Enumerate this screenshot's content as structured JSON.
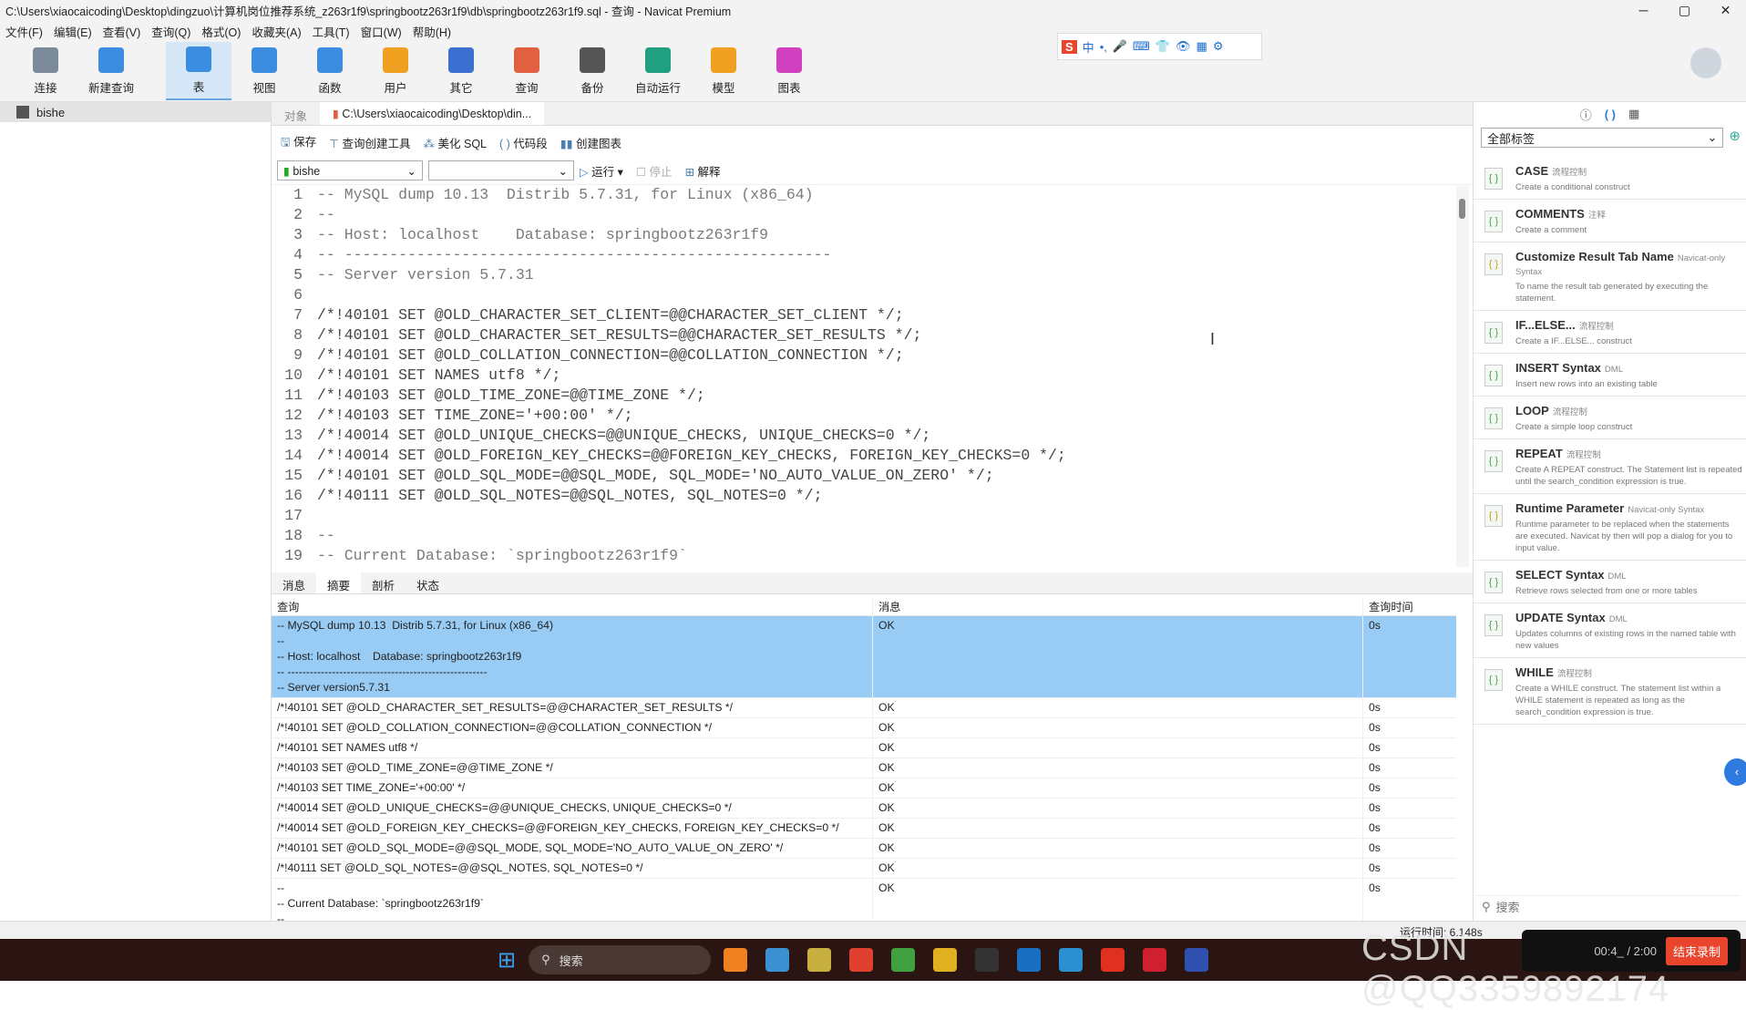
{
  "window": {
    "title": "C:\\Users\\xiaocaicoding\\Desktop\\dingzuo\\计算机岗位推荐系统_z263r1f9\\springbootz263r1f9\\db\\springbootz263r1f9.sql - 查询 - Navicat Premium",
    "minimize": "─",
    "maximize": "▢",
    "close": "✕"
  },
  "menu": [
    "文件(F)",
    "编辑(E)",
    "查看(V)",
    "查询(Q)",
    "格式(O)",
    "收藏夹(A)",
    "工具(T)",
    "窗口(W)",
    "帮助(H)"
  ],
  "toolbar": [
    {
      "label": "连接",
      "color": "#7a8a99"
    },
    {
      "label": "新建查询",
      "color": "#3b8de0"
    },
    {
      "label": "表",
      "color": "#3b8de0",
      "active": true
    },
    {
      "label": "视图",
      "color": "#3b8de0"
    },
    {
      "label": "函数",
      "color": "#3b8de0"
    },
    {
      "label": "用户",
      "color": "#f0a020"
    },
    {
      "label": "其它",
      "color": "#3b6fd0"
    },
    {
      "label": "查询",
      "color": "#e06040"
    },
    {
      "label": "备份",
      "color": "#555"
    },
    {
      "label": "自动运行",
      "color": "#20a080"
    },
    {
      "label": "模型",
      "color": "#f0a020"
    },
    {
      "label": "图表",
      "color": "#d040c0"
    }
  ],
  "ime": [
    "S",
    "中",
    "•,",
    "🎤",
    "⌨",
    "👕",
    "👁",
    "▦",
    "⚙"
  ],
  "sidebar": {
    "connection": "bishe"
  },
  "tabs": {
    "objects": "对象",
    "query": "C:\\Users\\xiaocaicoding\\Desktop\\din..."
  },
  "editor_toolbar": {
    "save": "保存",
    "builder": "查询创建工具",
    "beautify": "美化 SQL",
    "snippet": "代码段",
    "chart": "创建图表"
  },
  "selectors": {
    "connection": "bishe",
    "database": "",
    "run": "运行",
    "stop": "停止",
    "explain": "解释"
  },
  "code": [
    "-- MySQL dump 10.13  Distrib 5.7.31, for Linux (x86_64)",
    "--",
    "-- Host: localhost    Database: springbootz263r1f9",
    "-- ------------------------------------------------------",
    "-- Server version 5.7.31",
    "",
    "/*!40101 SET @OLD_CHARACTER_SET_CLIENT=@@CHARACTER_SET_CLIENT */;",
    "/*!40101 SET @OLD_CHARACTER_SET_RESULTS=@@CHARACTER_SET_RESULTS */;",
    "/*!40101 SET @OLD_COLLATION_CONNECTION=@@COLLATION_CONNECTION */;",
    "/*!40101 SET NAMES utf8 */;",
    "/*!40103 SET @OLD_TIME_ZONE=@@TIME_ZONE */;",
    "/*!40103 SET TIME_ZONE='+00:00' */;",
    "/*!40014 SET @OLD_UNIQUE_CHECKS=@@UNIQUE_CHECKS, UNIQUE_CHECKS=0 */;",
    "/*!40014 SET @OLD_FOREIGN_KEY_CHECKS=@@FOREIGN_KEY_CHECKS, FOREIGN_KEY_CHECKS=0 */;",
    "/*!40101 SET @OLD_SQL_MODE=@@SQL_MODE, SQL_MODE='NO_AUTO_VALUE_ON_ZERO' */;",
    "/*!40111 SET @OLD_SQL_NOTES=@@SQL_NOTES, SQL_NOTES=0 */;",
    "",
    "--",
    "-- Current Database: `springbootz263r1f9`"
  ],
  "result_tabs": [
    "消息",
    "摘要",
    "剖析",
    "状态"
  ],
  "result_active": 1,
  "grid": {
    "headers": [
      "查询",
      "消息",
      "查询时间"
    ],
    "rows": [
      {
        "query": [
          "-- MySQL dump 10.13  Distrib 5.7.31, for Linux (x86_64)",
          "--",
          "-- Host: localhost    Database: springbootz263r1f9",
          "-- ------------------------------------------------------",
          "-- Server version5.7.31"
        ],
        "msg": "OK",
        "time": "0s",
        "selected": true
      },
      {
        "query": [
          "/*!40101 SET @OLD_CHARACTER_SET_RESULTS=@@CHARACTER_SET_RESULTS */"
        ],
        "msg": "OK",
        "time": "0s"
      },
      {
        "query": [
          "/*!40101 SET @OLD_COLLATION_CONNECTION=@@COLLATION_CONNECTION */"
        ],
        "msg": "OK",
        "time": "0s"
      },
      {
        "query": [
          "/*!40101 SET NAMES utf8 */"
        ],
        "msg": "OK",
        "time": "0s"
      },
      {
        "query": [
          "/*!40103 SET @OLD_TIME_ZONE=@@TIME_ZONE */"
        ],
        "msg": "OK",
        "time": "0s"
      },
      {
        "query": [
          "/*!40103 SET TIME_ZONE='+00:00' */"
        ],
        "msg": "OK",
        "time": "0s"
      },
      {
        "query": [
          "/*!40014 SET @OLD_UNIQUE_CHECKS=@@UNIQUE_CHECKS, UNIQUE_CHECKS=0 */"
        ],
        "msg": "OK",
        "time": "0s"
      },
      {
        "query": [
          "/*!40014 SET @OLD_FOREIGN_KEY_CHECKS=@@FOREIGN_KEY_CHECKS, FOREIGN_KEY_CHECKS=0 */"
        ],
        "msg": "OK",
        "time": "0s"
      },
      {
        "query": [
          "/*!40101 SET @OLD_SQL_MODE=@@SQL_MODE, SQL_MODE='NO_AUTO_VALUE_ON_ZERO' */"
        ],
        "msg": "OK",
        "time": "0s"
      },
      {
        "query": [
          "/*!40111 SET @OLD_SQL_NOTES=@@SQL_NOTES, SQL_NOTES=0 */"
        ],
        "msg": "OK",
        "time": "0s"
      },
      {
        "query": [
          "--",
          "-- Current Database: `springbootz263r1f9`",
          "--"
        ],
        "msg": "OK",
        "time": "0s"
      }
    ]
  },
  "right_panel": {
    "tag_filter": "全部标签",
    "search_placeholder": "搜索",
    "snippets": [
      {
        "title": "CASE",
        "tag": "流程控制",
        "desc": "Create a conditional construct"
      },
      {
        "title": "COMMENTS",
        "tag": "注释",
        "desc": "Create a comment"
      },
      {
        "title": "Customize Result Tab Name",
        "tag": "Navicat-only Syntax",
        "desc": "To name the result tab generated by executing the statement."
      },
      {
        "title": "IF...ELSE...",
        "tag": "流程控制",
        "desc": "Create a IF...ELSE... construct"
      },
      {
        "title": "INSERT Syntax",
        "tag": "DML",
        "desc": "Insert new rows into an existing table"
      },
      {
        "title": "LOOP",
        "tag": "流程控制",
        "desc": "Create a simple loop construct"
      },
      {
        "title": "REPEAT",
        "tag": "流程控制",
        "desc": "Create A REPEAT construct. The Statement list is repeated until the search_condition expression is true."
      },
      {
        "title": "Runtime Parameter",
        "tag": "Navicat-only Syntax",
        "desc": "Runtime parameter to be replaced when the statements are executed. Navicat by then will pop a dialog for you to input value."
      },
      {
        "title": "SELECT Syntax",
        "tag": "DML",
        "desc": "Retrieve rows selected from one or more tables"
      },
      {
        "title": "UPDATE Syntax",
        "tag": "DML",
        "desc": "Updates columns of existing rows in the named table with new values"
      },
      {
        "title": "WHILE",
        "tag": "流程控制",
        "desc": "Create a WHILE construct. The statement list within a WHILE statement is repeated as long as the search_condition expression is true."
      }
    ]
  },
  "status": {
    "runtime": "运行时间: 6.148s"
  },
  "taskbar": {
    "search": "搜索",
    "apps": [
      "#f08020",
      "#3a90d0",
      "#c8b040",
      "#e04030",
      "#40a040",
      "#e0b020",
      "#333",
      "#1a70c0",
      "#2a90d0",
      "#e03020",
      "#d02030",
      "#3050b0"
    ]
  },
  "recording": {
    "time": "00:4_ / 2:00",
    "stop": "结束录制"
  },
  "watermark": "CSDN @QQ3359892174"
}
